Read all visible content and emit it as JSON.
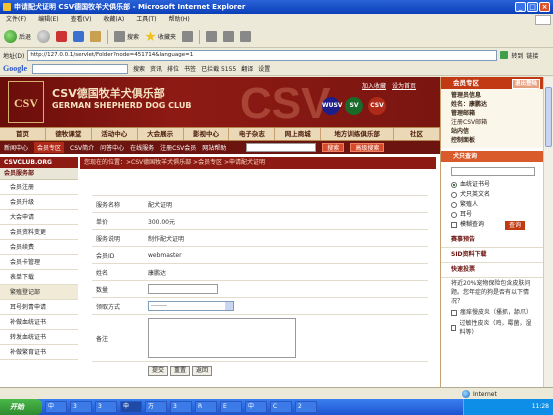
{
  "window": {
    "title": "申请配犬证明  CSV德国牧羊犬俱乐部 - Microsoft Internet Explorer",
    "minimize": "_",
    "maximize": "□",
    "close": "×"
  },
  "menu": [
    "文件(F)",
    "编辑(E)",
    "查看(V)",
    "收藏(A)",
    "工具(T)",
    "帮助(H)"
  ],
  "toolbar": {
    "back": "后退",
    "search": "搜索",
    "favorites": "收藏夹"
  },
  "address": {
    "label": "地址(D)",
    "url": "http://127.0.0.1/servlet/Folder?node=451714&language=1",
    "go": "转到",
    "links": "链接"
  },
  "googlebar": {
    "logo": "Google",
    "search": "搜索",
    "news": "资讯",
    "pagerank": "排位",
    "bookmarks": "书签",
    "blocked": "已拦截 5155",
    "translate": "翻译",
    "options": "设置"
  },
  "site": {
    "logo_text": "CSV",
    "name_cn": "CSV德国牧羊犬俱乐部",
    "name_en": "GERMAN SHEPHERD DOG CLUB",
    "watermark": "CSV",
    "top_links": [
      "加入收藏",
      "设为首页"
    ],
    "badges": [
      "WUSV",
      "SV",
      "CSV"
    ],
    "main_nav": [
      "首页",
      "德牧课堂",
      "活动中心",
      "大会展示",
      "影视中心",
      "电子杂志",
      "网上商城",
      "地方训练俱乐部",
      "社区"
    ],
    "sub_nav": [
      "新闻中心",
      "会员专区",
      "CSV简介",
      "问答中心",
      "在线服务",
      "注册CSV会员",
      "网站帮助"
    ],
    "sub_nav_active": "会员专区",
    "search_btn": "搜索",
    "adv_search_btn": "高级搜索"
  },
  "sidebar": {
    "head": "CSVCLUB.ORG",
    "section": "会员服务部",
    "items": [
      "会员注册",
      "会员升级",
      "大会申请",
      "会员资料变更",
      "会员续费",
      "会员卡管理",
      "表单下载",
      "繁殖登记部",
      "耳号刺青申请",
      "补做血统证书",
      "转发血统证书",
      "补做繁育证书"
    ],
    "highlight_index": 7
  },
  "breadcrumb": "您现在的位置：>CSV德国牧羊犬俱乐部 >会员专区 >申请配犬证明",
  "form": {
    "rows": [
      {
        "label": "服务名称",
        "value": "配犬证明"
      },
      {
        "label": "单价",
        "value": "300.00元"
      },
      {
        "label": "服务说明",
        "value": "制作配犬证明"
      },
      {
        "label": "会员ID",
        "value": "webmaster"
      },
      {
        "label": "姓名",
        "value": "康鹏达"
      }
    ],
    "quantity_label": "数量",
    "quantity_value": "",
    "pickup_label": "领取方式",
    "pickup_selected": "--------",
    "remarks_label": "备注",
    "remarks_value": "",
    "submit": "提交",
    "reset": "重置",
    "back": "返回"
  },
  "right": {
    "member_title": "会员专区",
    "logout": "退出登陆",
    "member_items": [
      "管理员信息",
      "姓名：康鹏达",
      "管理邮箱",
      "注册CSV邮箱",
      "站内信",
      "控制面板"
    ],
    "lookup_title": "犬只查询",
    "lookup_options": [
      "血统证书号",
      "犬只英文名",
      "繁殖人",
      "耳号"
    ],
    "lookup_selected": 0,
    "fuzzy_label": "模糊查询",
    "lookup_button": "查询",
    "event_title": "赛事预告",
    "download_title": "SID资料下载",
    "vote_title": "快速投票",
    "vote_text": "将近20%宠物保险包含皮肤问题。您年症的狗是否有以下情况？",
    "vote_options": [
      "瘙痒慢皮炎（搔抓，舔爪）",
      "过敏性皮炎（鸡，霉菌，湿料等）"
    ]
  },
  "status": {
    "text": "",
    "zone": "Internet"
  },
  "taskbar": {
    "start": "开始",
    "buttons": [
      "中",
      "3",
      "3",
      "申",
      "万",
      "3",
      "R",
      "E",
      "中",
      "C",
      "2"
    ],
    "clock": "11:28"
  },
  "colors": {
    "brand": "#8e1a14",
    "accent": "#c23a14",
    "xp_blue": "#1d54d0"
  }
}
